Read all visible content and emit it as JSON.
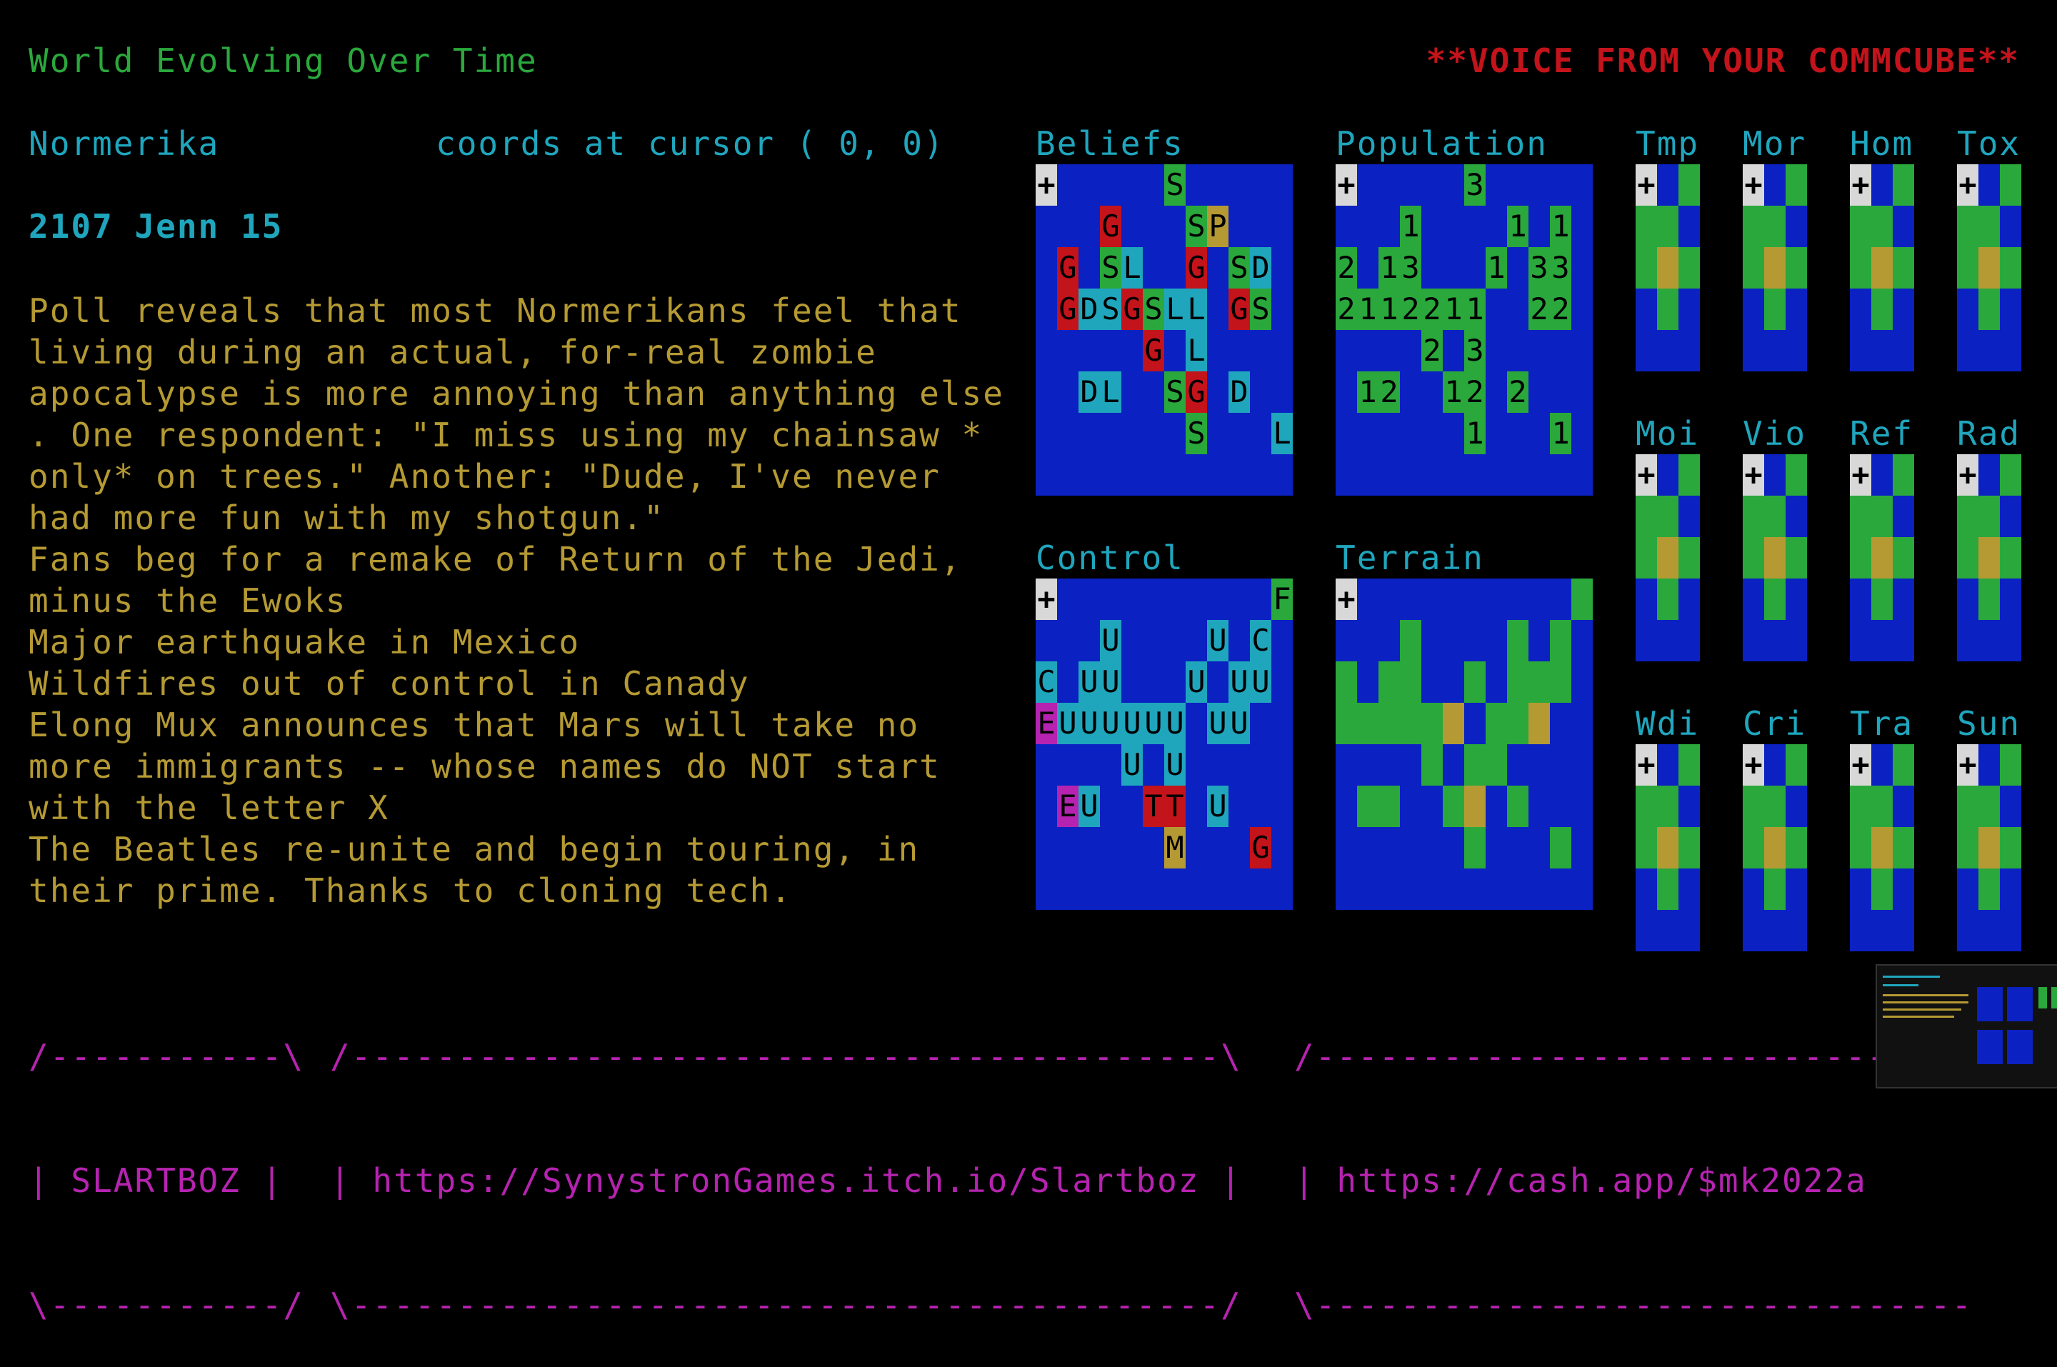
{
  "header": {
    "title": "World Evolving Over Time",
    "voice": "**VOICE FROM YOUR COMMCUBE**"
  },
  "status": {
    "region": "Normerika",
    "coords": "coords at cursor ( 0, 0)",
    "date": "2107 Jenn 15"
  },
  "news": [
    "Poll reveals that most Normerikans feel that",
    "living during an actual, for-real zombie",
    "apocalypse is more annoying than anything else",
    ". One respondent: \"I miss using my chainsaw *",
    "only* on trees.\" Another: \"Dude, I've never",
    "had more fun with my shotgun.\"",
    "Fans beg for a remake of Return of the Jedi,",
    "minus the Ewoks",
    "Major earthquake in Mexico",
    "Wildfires out of control in Canady",
    "Elong Mux announces that Mars will take no",
    "more immigrants -- whose names do NOT start",
    "with the letter X",
    "The Beatles re-unite and begin touring, in",
    "their prime. Thanks to cloning tech."
  ],
  "panels": {
    "beliefs": "Beliefs",
    "population": "Population",
    "control": "Control",
    "terrain": "Terrain"
  },
  "mini_panels": [
    "Tmp",
    "Mor",
    "Hom",
    "Tox",
    "Moi",
    "Vio",
    "Ref",
    "Rad",
    "Wdi",
    "Cri",
    "Tra",
    "Sun"
  ],
  "footer": {
    "box1": [
      "/-----------\\",
      "| SLARTBOZ |",
      "\\-----------/"
    ],
    "box2": [
      "/-----------------------------------------\\",
      "| https://SynystronGames.itch.io/Slartboz |",
      "\\-----------------------------------------/"
    ],
    "box3": [
      "/-------------------------------",
      "| https://cash.app/$mk2022a",
      "\\-------------------------------"
    ]
  },
  "map_glyphs": {
    "plus": "+",
    "beliefs": [
      {
        "c": 6,
        "r": 0,
        "ch": "S",
        "col": "#2aa83c"
      },
      {
        "c": 3,
        "r": 1,
        "ch": "G",
        "col": "#c3131b"
      },
      {
        "c": 7,
        "r": 1,
        "ch": "S",
        "col": "#2aa83c"
      },
      {
        "c": 8,
        "r": 1,
        "ch": "P",
        "col": "#b59a33"
      },
      {
        "c": 1,
        "r": 2,
        "ch": "G",
        "col": "#c3131b"
      },
      {
        "c": 3,
        "r": 2,
        "ch": "S",
        "col": "#2aa83c"
      },
      {
        "c": 4,
        "r": 2,
        "ch": "L",
        "col": "#1fa6bd"
      },
      {
        "c": 7,
        "r": 2,
        "ch": "G",
        "col": "#c3131b"
      },
      {
        "c": 9,
        "r": 2,
        "ch": "S",
        "col": "#2aa83c"
      },
      {
        "c": 10,
        "r": 2,
        "ch": "D",
        "col": "#1fa6bd"
      },
      {
        "c": 1,
        "r": 3,
        "ch": "G",
        "col": "#c3131b"
      },
      {
        "c": 2,
        "r": 3,
        "ch": "D",
        "col": "#1fa6bd"
      },
      {
        "c": 3,
        "r": 3,
        "ch": "S",
        "col": "#1fa6bd"
      },
      {
        "c": 4,
        "r": 3,
        "ch": "G",
        "col": "#c3131b"
      },
      {
        "c": 5,
        "r": 3,
        "ch": "S",
        "col": "#2aa83c"
      },
      {
        "c": 6,
        "r": 3,
        "ch": "L",
        "col": "#1fa6bd"
      },
      {
        "c": 7,
        "r": 3,
        "ch": "L",
        "col": "#1fa6bd"
      },
      {
        "c": 9,
        "r": 3,
        "ch": "G",
        "col": "#c3131b"
      },
      {
        "c": 10,
        "r": 3,
        "ch": "S",
        "col": "#2aa83c"
      },
      {
        "c": 5,
        "r": 4,
        "ch": "G",
        "col": "#c3131b"
      },
      {
        "c": 7,
        "r": 4,
        "ch": "L",
        "col": "#1fa6bd"
      },
      {
        "c": 2,
        "r": 5,
        "ch": "D",
        "col": "#1fa6bd"
      },
      {
        "c": 3,
        "r": 5,
        "ch": "L",
        "col": "#1fa6bd"
      },
      {
        "c": 6,
        "r": 5,
        "ch": "S",
        "col": "#2aa83c"
      },
      {
        "c": 7,
        "r": 5,
        "ch": "G",
        "col": "#c3131b"
      },
      {
        "c": 9,
        "r": 5,
        "ch": "D",
        "col": "#1fa6bd"
      },
      {
        "c": 7,
        "r": 6,
        "ch": "S",
        "col": "#2aa83c"
      },
      {
        "c": 11,
        "r": 6,
        "ch": "L",
        "col": "#1fa6bd"
      }
    ],
    "population": [
      {
        "c": 6,
        "r": 0,
        "ch": "3",
        "col": "#2aa83c"
      },
      {
        "c": 3,
        "r": 1,
        "ch": "1",
        "col": "#2aa83c"
      },
      {
        "c": 8,
        "r": 1,
        "ch": "1",
        "col": "#2aa83c"
      },
      {
        "c": 10,
        "r": 1,
        "ch": "1",
        "col": "#2aa83c"
      },
      {
        "c": 0,
        "r": 2,
        "ch": "2",
        "col": "#2aa83c"
      },
      {
        "c": 2,
        "r": 2,
        "ch": "1",
        "col": "#2aa83c"
      },
      {
        "c": 3,
        "r": 2,
        "ch": "3",
        "col": "#2aa83c"
      },
      {
        "c": 7,
        "r": 2,
        "ch": "1",
        "col": "#2aa83c"
      },
      {
        "c": 9,
        "r": 2,
        "ch": "3",
        "col": "#2aa83c"
      },
      {
        "c": 10,
        "r": 2,
        "ch": "3",
        "col": "#2aa83c"
      },
      {
        "c": 0,
        "r": 3,
        "ch": "2",
        "col": "#2aa83c"
      },
      {
        "c": 1,
        "r": 3,
        "ch": "1",
        "col": "#2aa83c"
      },
      {
        "c": 2,
        "r": 3,
        "ch": "1",
        "col": "#2aa83c"
      },
      {
        "c": 3,
        "r": 3,
        "ch": "2",
        "col": "#2aa83c"
      },
      {
        "c": 4,
        "r": 3,
        "ch": "2",
        "col": "#2aa83c"
      },
      {
        "c": 5,
        "r": 3,
        "ch": "1",
        "col": "#2aa83c"
      },
      {
        "c": 6,
        "r": 3,
        "ch": "1",
        "col": "#2aa83c"
      },
      {
        "c": 9,
        "r": 3,
        "ch": "2",
        "col": "#2aa83c"
      },
      {
        "c": 10,
        "r": 3,
        "ch": "2",
        "col": "#2aa83c"
      },
      {
        "c": 4,
        "r": 4,
        "ch": "2",
        "col": "#2aa83c"
      },
      {
        "c": 6,
        "r": 4,
        "ch": "3",
        "col": "#2aa83c"
      },
      {
        "c": 1,
        "r": 5,
        "ch": "1",
        "col": "#2aa83c"
      },
      {
        "c": 2,
        "r": 5,
        "ch": "2",
        "col": "#2aa83c"
      },
      {
        "c": 5,
        "r": 5,
        "ch": "1",
        "col": "#2aa83c"
      },
      {
        "c": 6,
        "r": 5,
        "ch": "2",
        "col": "#2aa83c"
      },
      {
        "c": 8,
        "r": 5,
        "ch": "2",
        "col": "#2aa83c"
      },
      {
        "c": 6,
        "r": 6,
        "ch": "1",
        "col": "#2aa83c"
      },
      {
        "c": 10,
        "r": 6,
        "ch": "1",
        "col": "#2aa83c"
      }
    ],
    "control": [
      {
        "c": 11,
        "r": 0,
        "ch": "F",
        "col": "#2aa83c"
      },
      {
        "c": 3,
        "r": 1,
        "ch": "U",
        "col": "#1fa6bd"
      },
      {
        "c": 8,
        "r": 1,
        "ch": "U",
        "col": "#1fa6bd"
      },
      {
        "c": 10,
        "r": 1,
        "ch": "C",
        "col": "#1fa6bd"
      },
      {
        "c": 0,
        "r": 2,
        "ch": "C",
        "col": "#1fa6bd"
      },
      {
        "c": 2,
        "r": 2,
        "ch": "U",
        "col": "#1fa6bd"
      },
      {
        "c": 3,
        "r": 2,
        "ch": "U",
        "col": "#1fa6bd"
      },
      {
        "c": 7,
        "r": 2,
        "ch": "U",
        "col": "#1fa6bd"
      },
      {
        "c": 9,
        "r": 2,
        "ch": "U",
        "col": "#1fa6bd"
      },
      {
        "c": 10,
        "r": 2,
        "ch": "U",
        "col": "#1fa6bd"
      },
      {
        "c": 0,
        "r": 3,
        "ch": "E",
        "col": "#b623b0"
      },
      {
        "c": 1,
        "r": 3,
        "ch": "U",
        "col": "#1fa6bd"
      },
      {
        "c": 2,
        "r": 3,
        "ch": "U",
        "col": "#1fa6bd"
      },
      {
        "c": 3,
        "r": 3,
        "ch": "U",
        "col": "#1fa6bd"
      },
      {
        "c": 4,
        "r": 3,
        "ch": "U",
        "col": "#1fa6bd"
      },
      {
        "c": 5,
        "r": 3,
        "ch": "U",
        "col": "#1fa6bd"
      },
      {
        "c": 6,
        "r": 3,
        "ch": "U",
        "col": "#1fa6bd"
      },
      {
        "c": 8,
        "r": 3,
        "ch": "U",
        "col": "#1fa6bd"
      },
      {
        "c": 9,
        "r": 3,
        "ch": "U",
        "col": "#1fa6bd"
      },
      {
        "c": 4,
        "r": 4,
        "ch": "U",
        "col": "#1fa6bd"
      },
      {
        "c": 6,
        "r": 4,
        "ch": "U",
        "col": "#1fa6bd"
      },
      {
        "c": 1,
        "r": 5,
        "ch": "E",
        "col": "#b623b0"
      },
      {
        "c": 2,
        "r": 5,
        "ch": "U",
        "col": "#1fa6bd"
      },
      {
        "c": 5,
        "r": 5,
        "ch": "T",
        "col": "#c3131b"
      },
      {
        "c": 6,
        "r": 5,
        "ch": "T",
        "col": "#c3131b"
      },
      {
        "c": 8,
        "r": 5,
        "ch": "U",
        "col": "#1fa6bd"
      },
      {
        "c": 6,
        "r": 6,
        "ch": "M",
        "col": "#b59a33"
      },
      {
        "c": 10,
        "r": 6,
        "ch": "G",
        "col": "#c3131b"
      }
    ]
  },
  "colors": {
    "ocean": "#0b21c1",
    "land": "#2aa83c",
    "sand": "#b59a33",
    "plus_bg": "#d8d8d8"
  }
}
